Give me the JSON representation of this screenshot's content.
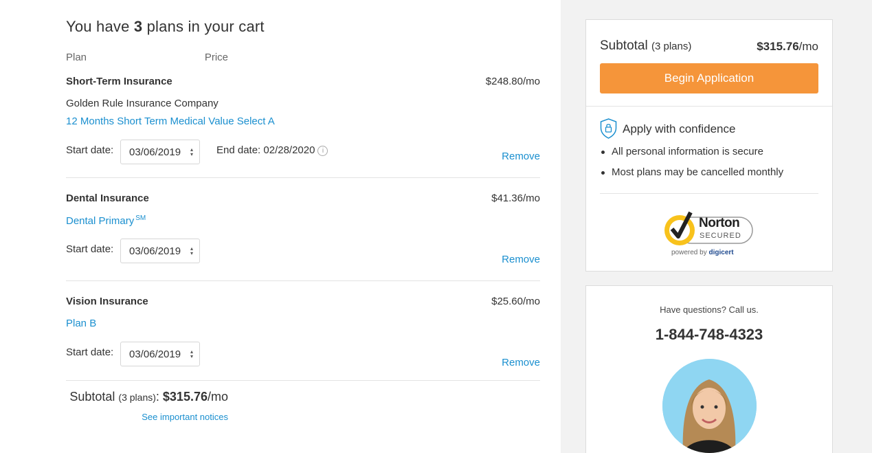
{
  "cart": {
    "title_prefix": "You have ",
    "count": "3",
    "title_suffix": " plans in your cart",
    "col_plan": "Plan",
    "col_price": "Price"
  },
  "plans": [
    {
      "name": "Short-Term Insurance",
      "price": "$248.80/mo",
      "company": "Golden Rule Insurance Company",
      "link": "12 Months Short Term Medical Value Select A",
      "start_label": "Start date:",
      "start_date": "03/06/2019",
      "end_date_text": "End date: 02/28/2020",
      "remove": "Remove"
    },
    {
      "name": "Dental Insurance",
      "price": "$41.36/mo",
      "link": "Dental Primary",
      "link_sup": "SM",
      "start_label": "Start date:",
      "start_date": "03/06/2019",
      "remove": "Remove"
    },
    {
      "name": "Vision Insurance",
      "price": "$25.60/mo",
      "link": "Plan B",
      "start_label": "Start date:",
      "start_date": "03/06/2019",
      "remove": "Remove"
    }
  ],
  "summary": {
    "subtotal_label": "Subtotal ",
    "plans_count": "(3 plans)",
    "colon": ": ",
    "amount": "$315.76",
    "per": "/mo",
    "notices": "See important notices"
  },
  "sidebar": {
    "subtotal_label": "Subtotal ",
    "plans_count": "(3 plans)",
    "amount": "$315.76",
    "per": "/mo",
    "begin_button": "Begin Application",
    "confidence_title": "Apply with confidence",
    "bullets": [
      "All personal information is secure",
      "Most plans may be cancelled monthly"
    ],
    "norton_name": "Norton",
    "norton_secured": "SECURED",
    "norton_powered": "powered by ",
    "norton_brand": "digicert",
    "questions": "Have questions? Call us.",
    "phone": "1-844-748-4323"
  },
  "colors": {
    "accent_orange": "#f5953a",
    "link_blue": "#1a8fcf",
    "aside_bg": "#f2f2f2",
    "norton_yellow": "#f8c21c"
  }
}
